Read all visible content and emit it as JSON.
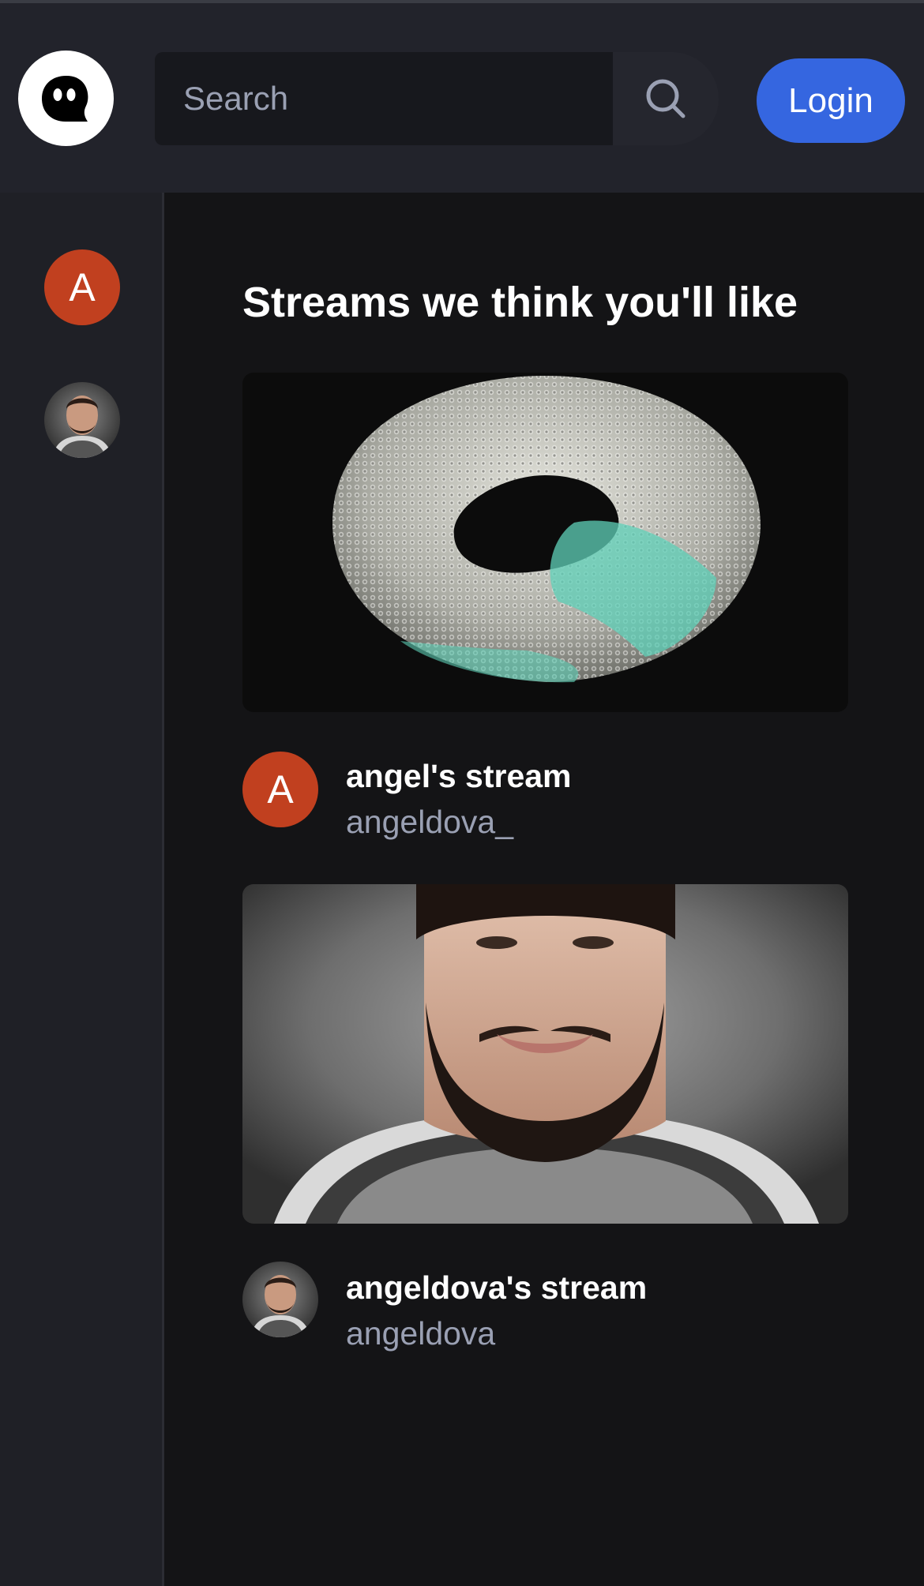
{
  "app": {
    "logo_icon": "ghost-icon"
  },
  "search": {
    "placeholder": "Search",
    "icon": "search-icon"
  },
  "header": {
    "login_label": "Login"
  },
  "sidebar": {
    "items": [
      {
        "type": "letter",
        "letter": "A",
        "color": "#c1401f"
      },
      {
        "type": "portrait"
      }
    ]
  },
  "main": {
    "title": "Streams we think you'll like",
    "streams": [
      {
        "title": "angel's stream",
        "username": "angeldova_",
        "avatar_letter": "A",
        "avatar_color": "#c1401f",
        "thumbnail": "teal-torus-render"
      },
      {
        "title": "angeldova's stream",
        "username": "angeldova",
        "avatar": "portrait",
        "thumbnail": "bearded-man-portrait"
      }
    ]
  },
  "colors": {
    "accent": "#3566e0",
    "header_bg": "#22232b",
    "page_bg": "#141416",
    "muted_text": "#9aa0b3"
  }
}
